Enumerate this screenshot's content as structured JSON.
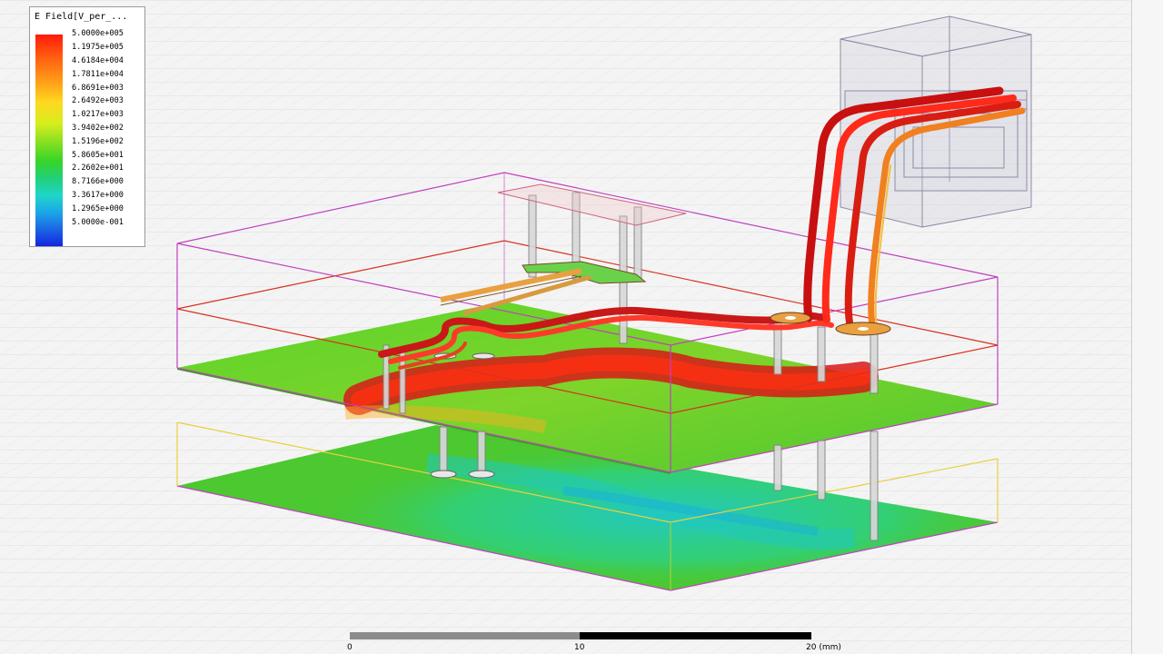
{
  "legend": {
    "title": "E Field[V_per_...",
    "labels": [
      "5.0000e+005",
      "1.1975e+005",
      "4.6184e+004",
      "1.7811e+004",
      "6.8691e+003",
      "2.6492e+003",
      "1.0217e+003",
      "3.9402e+002",
      "1.5196e+002",
      "5.8605e+001",
      "2.2602e+001",
      "8.7166e+000",
      "3.3617e+000",
      "1.2965e+000",
      "5.0000e-001"
    ]
  },
  "scale_bar": {
    "ticks": [
      "0",
      "10",
      "20 (mm)"
    ]
  },
  "colors": {
    "field_max": "#ff1a0a",
    "field_mid": "#4cd22a",
    "field_min": "#1424e0",
    "outline_magenta": "#c040c0",
    "outline_red": "#d83020",
    "outline_yellow": "#e8d040",
    "outline_green": "#a0d040"
  }
}
